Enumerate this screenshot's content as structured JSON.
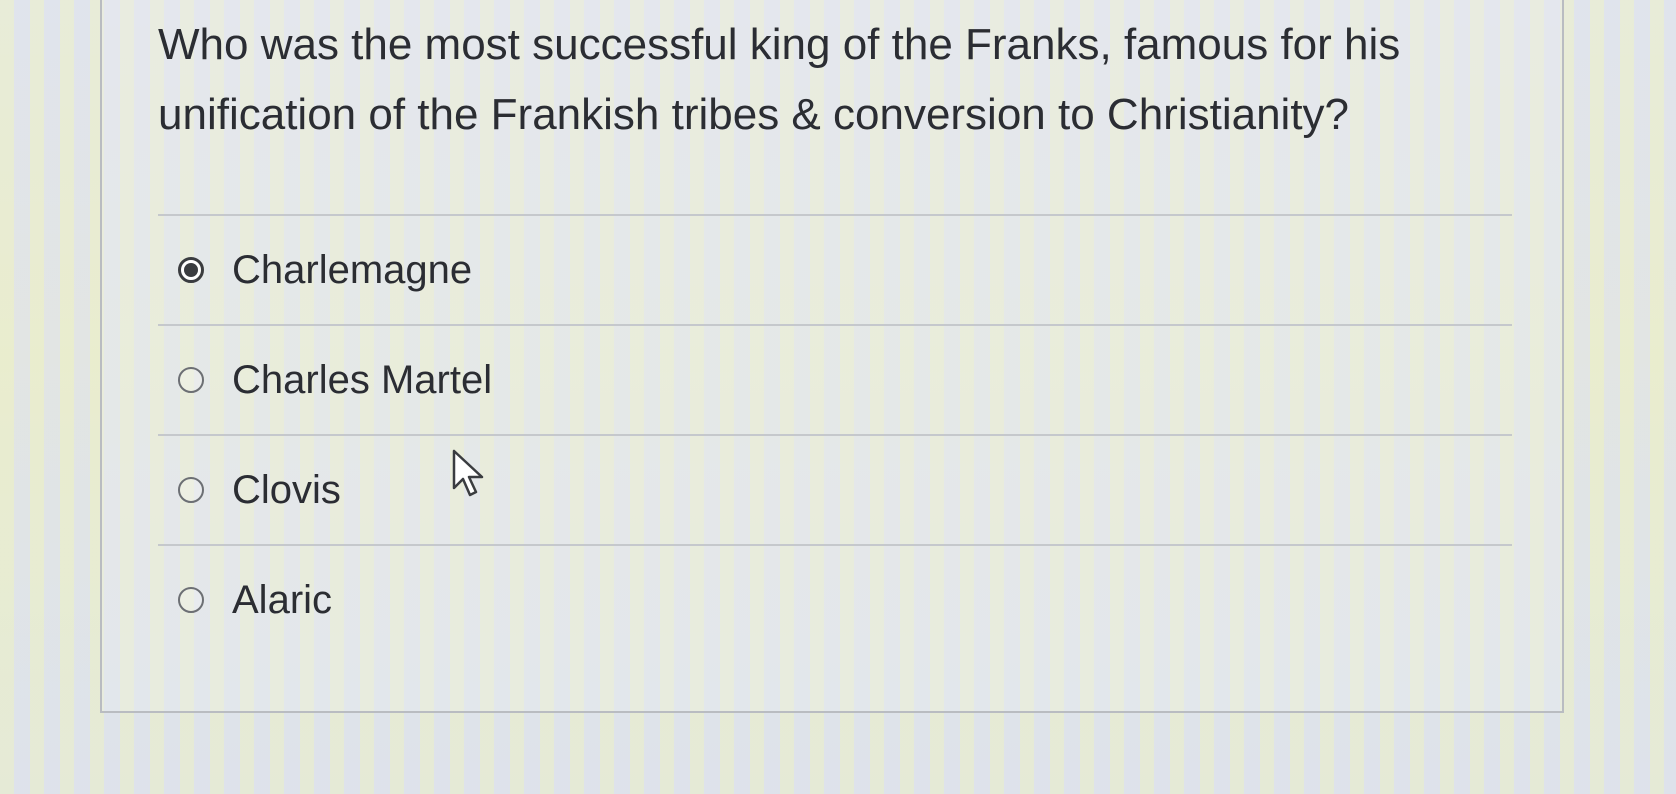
{
  "question": {
    "line1": "Who was the most successful king of the Franks, famous for his",
    "line2": "unification of the Frankish tribes & conversion to Christianity?"
  },
  "answers": [
    {
      "label": "Charlemagne",
      "selected": true
    },
    {
      "label": "Charles Martel",
      "selected": false
    },
    {
      "label": "Clovis",
      "selected": false
    },
    {
      "label": "Alaric",
      "selected": false
    }
  ],
  "colors": {
    "text": "#2b2d33",
    "radio_border": "#6c6f74",
    "separator": "#c5c8cc"
  },
  "icons": {
    "cursor": "mouse-pointer-icon",
    "radio_selected": "radio-selected-icon",
    "radio_unselected": "radio-unselected-icon"
  }
}
